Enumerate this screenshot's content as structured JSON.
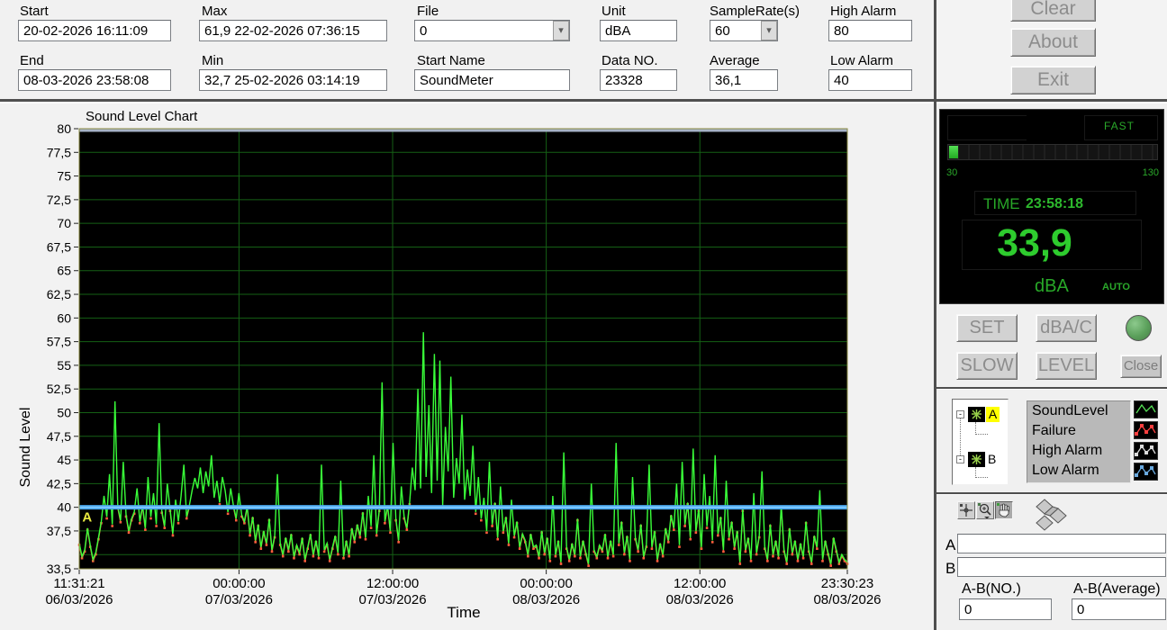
{
  "icons": {
    "dropdown": "▾",
    "minus": "-"
  },
  "header": {
    "fields": {
      "start": {
        "label": "Start",
        "value": "20-02-2026 16:11:09"
      },
      "end": {
        "label": "End",
        "value": "08-03-2026 23:58:08"
      },
      "max": {
        "label": "Max",
        "value": "61,9 22-02-2026 07:36:15"
      },
      "min": {
        "label": "Min",
        "value": "32,7 25-02-2026 03:14:19"
      },
      "file": {
        "label": "File",
        "value": "0"
      },
      "start_name": {
        "label": "Start Name",
        "value": "SoundMeter"
      },
      "unit": {
        "label": "Unit",
        "value": "dBA"
      },
      "data_no": {
        "label": "Data NO.",
        "value": "23328"
      },
      "sample_rate": {
        "label": "SampleRate(s)",
        "value": "60"
      },
      "average": {
        "label": "Average",
        "value": "36,1"
      },
      "high_alarm": {
        "label": "High Alarm",
        "value": "80"
      },
      "low_alarm": {
        "label": "Low Alarm",
        "value": "40"
      }
    },
    "buttons": {
      "clear": "Clear",
      "about": "About",
      "exit": "Exit"
    }
  },
  "meter": {
    "mode_label": "FAST",
    "scale_min": "30",
    "scale_max": "130",
    "time_label": "TIME",
    "time_value": "23:58:18",
    "value": "33,9",
    "unit": "dBA",
    "auto_label": "AUTO",
    "level_fraction": 0.039,
    "green": "#2db82d"
  },
  "controls": {
    "set": "SET",
    "dbac": "dBA/C",
    "slow": "SLOW",
    "level": "LEVEL",
    "close": "Close"
  },
  "legend": {
    "tree": {
      "node_a": "A",
      "node_b": "B"
    },
    "items": [
      {
        "label": "SoundLevel",
        "color": "#55e055",
        "markers": false
      },
      {
        "label": "Failure",
        "color": "#ff4040",
        "markers": true
      },
      {
        "label": "High Alarm",
        "color": "#dcdcdc",
        "markers": true
      },
      {
        "label": "Low Alarm",
        "color": "#6aaae0",
        "markers": true
      }
    ]
  },
  "analysis": {
    "a_label": "A",
    "b_label": "B",
    "a_value": "",
    "b_value": "",
    "ab_no": {
      "label": "A-B(NO.)",
      "value": "0"
    },
    "ab_avg": {
      "label": "A-B(Average)",
      "value": "0"
    }
  },
  "chart_data": {
    "type": "line",
    "title": "Sound Level Chart",
    "xlabel": "Time",
    "ylabel": "Sound Level",
    "ylim": [
      33.5,
      80
    ],
    "grid": true,
    "total_points": 23328,
    "y_tick_labels": [
      {
        "v": 80,
        "t": "80"
      },
      {
        "v": 77.5,
        "t": "77,5"
      },
      {
        "v": 75,
        "t": "75"
      },
      {
        "v": 72.5,
        "t": "72,5"
      },
      {
        "v": 70,
        "t": "70"
      },
      {
        "v": 67.5,
        "t": "67,5"
      },
      {
        "v": 65,
        "t": "65"
      },
      {
        "v": 62.5,
        "t": "62,5"
      },
      {
        "v": 60,
        "t": "60"
      },
      {
        "v": 57.5,
        "t": "57,5"
      },
      {
        "v": 55,
        "t": "55"
      },
      {
        "v": 52.5,
        "t": "52,5"
      },
      {
        "v": 50,
        "t": "50"
      },
      {
        "v": 47.5,
        "t": "47,5"
      },
      {
        "v": 45,
        "t": "45"
      },
      {
        "v": 42.5,
        "t": "42,5"
      },
      {
        "v": 40,
        "t": "40"
      },
      {
        "v": 37.5,
        "t": "37,5"
      },
      {
        "v": 33.5,
        "t": "33,5"
      }
    ],
    "y_gridlines": [
      77.5,
      75,
      72.5,
      70,
      67.5,
      65,
      62.5,
      60,
      57.5,
      55,
      52.5,
      50,
      47.5,
      45,
      42.5,
      40,
      37.5,
      35
    ],
    "x_ticks": [
      {
        "time": "11:31:21",
        "date": "06/03/2026",
        "f": 0.0
      },
      {
        "time": "00:00:00",
        "date": "07/03/2026",
        "f": 0.208
      },
      {
        "time": "12:00:00",
        "date": "07/03/2026",
        "f": 0.408
      },
      {
        "time": "00:00:00",
        "date": "08/03/2026",
        "f": 0.608
      },
      {
        "time": "12:00:00",
        "date": "08/03/2026",
        "f": 0.808
      },
      {
        "time": "23:30:23",
        "date": "08/03/2026",
        "f": 1.0
      }
    ],
    "high_alarm": 80,
    "low_alarm": 40,
    "cursor": {
      "label": "A",
      "x_frac": 0.004,
      "value": 40
    },
    "colors": {
      "plot_bg": "#000000",
      "grid": "#156015",
      "trace": "#39ff39",
      "failure": "#ff5f3d",
      "low_alarm_line": "#4aa8f0",
      "low_alarm_core": "#8cd0ff",
      "high_alarm_line": "#a6b2c6",
      "cursor": "#e8e840",
      "frame": "#8a8a40"
    },
    "series": [
      {
        "name": "SoundLevel",
        "color": "#39ff39",
        "values": [
          36.2,
          34.8,
          35.5,
          37.8,
          36.0,
          34.5,
          35.2,
          36.8,
          38.5,
          41.2,
          39.0,
          43.5,
          38.2,
          51.2,
          40.1,
          38.6,
          44.8,
          39.2,
          37.5,
          38.8,
          39.5,
          42.0,
          38.5,
          40.2,
          37.8,
          43.2,
          39.0,
          41.5,
          38.2,
          48.9,
          39.6,
          38.0,
          42.5,
          39.8,
          37.2,
          40.8,
          38.5,
          41.2,
          44.5,
          39.0,
          40.2,
          41.8,
          43.1,
          42.0,
          44.2,
          41.5,
          43.8,
          42.2,
          45.5,
          41.0,
          42.8,
          40.5,
          43.2,
          41.8,
          39.5,
          42.0,
          40.2,
          38.8,
          41.5,
          39.2,
          38.5,
          40.1,
          37.2,
          39.0,
          36.5,
          38.2,
          35.8,
          37.5,
          36.2,
          38.8,
          35.5,
          37.0,
          43.5,
          36.2,
          35.0,
          36.8,
          35.5,
          37.2,
          34.8,
          36.0,
          35.2,
          36.8,
          34.5,
          35.8,
          37.2,
          35.0,
          36.5,
          34.8,
          44.5,
          35.5,
          36.2,
          34.5,
          35.8,
          37.0,
          35.2,
          42.8,
          34.8,
          36.5,
          35.0,
          37.8,
          36.5,
          38.2,
          37.0,
          39.5,
          36.8,
          41.2,
          38.0,
          45.5,
          37.2,
          39.8,
          53.2,
          38.5,
          40.2,
          37.5,
          46.8,
          38.8,
          36.5,
          42.2,
          39.0,
          37.8,
          40.5,
          44.2,
          41.8,
          52.5,
          42.0,
          58.5,
          43.2,
          50.8,
          41.5,
          56.2,
          42.8,
          55.5,
          40.2,
          48.5,
          43.8,
          53.8,
          41.0,
          45.2,
          42.5,
          49.8,
          40.8,
          44.0,
          41.2,
          46.5,
          39.5,
          43.2,
          38.8,
          41.0,
          37.5,
          44.8,
          38.2,
          40.5,
          36.8,
          42.2,
          37.5,
          39.0,
          36.2,
          40.8,
          37.0,
          38.5,
          35.8,
          37.2,
          36.5,
          35.0,
          37.2,
          35.8,
          36.0,
          34.8,
          37.5,
          35.2,
          36.8,
          34.5,
          41.2,
          35.0,
          36.5,
          34.2,
          45.8,
          35.8,
          34.5,
          36.2,
          35.0,
          38.8,
          34.8,
          36.5,
          35.2,
          34.0,
          42.5,
          35.5,
          34.8,
          36.0,
          35.5,
          37.2,
          34.8,
          36.5,
          35.0,
          46.8,
          36.2,
          38.5,
          35.2,
          37.0,
          34.5,
          43.2,
          36.8,
          35.5,
          38.2,
          34.8,
          36.0,
          44.5,
          35.8,
          37.5,
          34.5,
          36.2,
          35.0,
          37.8,
          36.5,
          39.2,
          37.8,
          42.5,
          36.0,
          44.8,
          38.2,
          40.5,
          36.8,
          46.2,
          37.5,
          39.8,
          35.8,
          43.5,
          38.0,
          41.2,
          36.5,
          45.5,
          37.2,
          39.0,
          35.5,
          42.8,
          36.8,
          38.5,
          35.8,
          37.5,
          34.2,
          39.8,
          35.5,
          36.8,
          34.5,
          41.5,
          35.2,
          37.0,
          43.8,
          35.8,
          34.5,
          38.2,
          35.0,
          36.5,
          34.8,
          40.2,
          35.5,
          34.2,
          37.8,
          35.2,
          36.5,
          34.5,
          36.2,
          34.8,
          38.5,
          35.5,
          34.2,
          37.0,
          35.8,
          41.8,
          34.5,
          36.5,
          35.2,
          34.0,
          36.8,
          35.5,
          34.2,
          35.0,
          34.5,
          34.2
        ]
      },
      {
        "name": "Failure",
        "color": "#ff5f3d",
        "rule": "markers on points below low alarm"
      }
    ]
  }
}
